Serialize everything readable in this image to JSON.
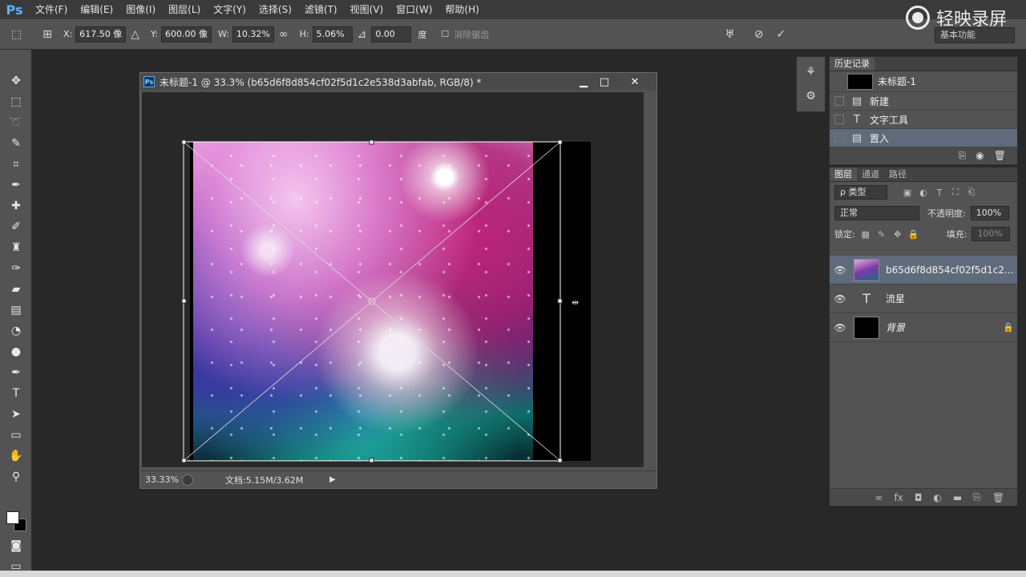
{
  "app": {
    "logo": "Ps",
    "menu": [
      "文件(F)",
      "编辑(E)",
      "图像(I)",
      "图层(L)",
      "文字(Y)",
      "选择(S)",
      "滤镜(T)",
      "视图(V)",
      "窗口(W)",
      "帮助(H)"
    ],
    "watermark": "轻映录屏"
  },
  "options": {
    "x_label": "X:",
    "x_value": "617.50 像",
    "y_label": "Y:",
    "y_value": "600.00 像",
    "w_label": "W:",
    "w_value": "10.32%",
    "h_label": "H:",
    "h_value": "5.06%",
    "angle_value": "0.00",
    "angle_unit": "度",
    "antialias_label": "消除锯齿",
    "workspace": "基本功能"
  },
  "document": {
    "title": "未标题-1 @ 33.3% (b65d6f8d854cf02f5d1c2e538d3abfab, RGB/8) *",
    "zoom": "33.33%",
    "doc_info": "文档:5.15M/3.62M"
  },
  "history": {
    "tab": "历史记录",
    "snapshot": "未标题-1",
    "items": [
      {
        "icon": "document-icon",
        "label": "新建"
      },
      {
        "icon": "text-tool-icon",
        "label": "文字工具"
      },
      {
        "icon": "document-icon",
        "label": "置入"
      }
    ]
  },
  "layers": {
    "tabs": [
      "图层",
      "通道",
      "路径"
    ],
    "filter": "ρ 类型",
    "blend_mode": "正常",
    "opacity_label": "不透明度:",
    "opacity_value": "100%",
    "lock_label": "锁定:",
    "fill_label": "填充:",
    "fill_value": "100%",
    "items": [
      {
        "name": "b65d6f8d854cf02f5d1c2...",
        "type": "smart-object"
      },
      {
        "name": "流星",
        "type": "text"
      },
      {
        "name": "背景",
        "type": "background"
      }
    ]
  }
}
